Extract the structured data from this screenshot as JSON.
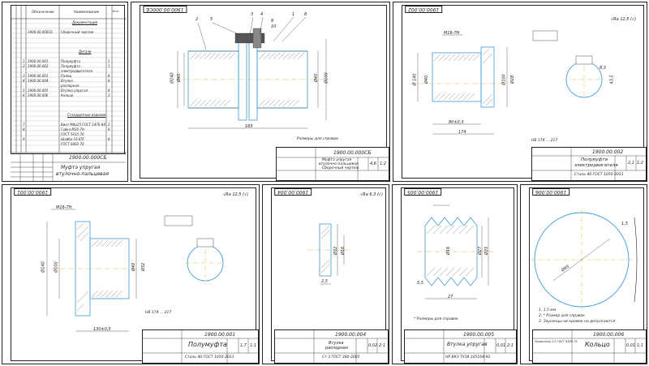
{
  "spec_sheet": {
    "header": {
      "col_designation": "Обозначение",
      "col_name": "Наименование",
      "col_qty": "Кол."
    },
    "section_docs": "Документация",
    "doc_rows": [
      {
        "code": "1900.00.000СБ",
        "name": "Сборочный чертеж"
      }
    ],
    "section_parts": "Детали",
    "part_rows": [
      {
        "pos": "1",
        "code": "1900.00.001",
        "name": "Полумуфта",
        "qty": "1"
      },
      {
        "pos": "2",
        "code": "1900.00.002",
        "name": "Полумуфта",
        "qty": "1"
      },
      {
        "pos": "",
        "code": "",
        "name": "электродвигателя",
        "qty": ""
      },
      {
        "pos": "3",
        "code": "1900.00.003",
        "name": "Палец",
        "qty": "8"
      },
      {
        "pos": "4",
        "code": "1900.00.004",
        "name": "Втулка",
        "qty": "8"
      },
      {
        "pos": "",
        "code": "",
        "name": "распорная",
        "qty": ""
      },
      {
        "pos": "5",
        "code": "1900.00.005",
        "name": "Втулка упругая",
        "qty": "8"
      },
      {
        "pos": "6",
        "code": "1900.00.006",
        "name": "Кольцо",
        "qty": "2"
      }
    ],
    "section_standard": "Стандартные изделия",
    "std_rows": [
      {
        "pos": "7",
        "name": "Винт М4х25 ГОСТ 1476-84",
        "qty": "2"
      },
      {
        "pos": "8",
        "name": "Гайка М16-7Н",
        "qty": "8"
      },
      {
        "pos": "",
        "name": "ГОСТ 5915-70",
        "qty": ""
      },
      {
        "pos": "9",
        "name": "Шайба 16.65Г",
        "qty": "8"
      },
      {
        "pos": "",
        "name": "ГОСТ 6402-70",
        "qty": ""
      }
    ],
    "title_code": "1900.00.000СБ",
    "title_name_1": "Муфта упругая",
    "title_name_2": "втулочно-пальцевая"
  },
  "assembly_sheet": {
    "corner_code": "1900.00.000СБ",
    "positions": [
      "2",
      "5",
      "3",
      "4",
      "9",
      "10",
      "1",
      "8"
    ],
    "dims": [
      "Ø140",
      "Ø40",
      "Ø40",
      "Ø100",
      "165"
    ],
    "note": "Размеры для справок",
    "title_code": "1900.00.000СБ",
    "title_name_1": "Муфта упругая",
    "title_name_2": "втулочно-пальцевая",
    "title_name_3": "Сборочный чертеж",
    "scale": "1:2",
    "mass": "4,6"
  },
  "motor_halfcoupling_sheet": {
    "corner_code": "1900.00.002",
    "roughness": "√Ra 12,5 (√)",
    "dims": [
      "Ø 140",
      "Ø40",
      "Ø100",
      "Ø28",
      "80±0,3",
      "174",
      "M16-7H",
      "8,3",
      "43,5"
    ],
    "hardness": "HB 174 ... 217",
    "title_code": "1900.00.002",
    "title_name_1": "Полумуфта",
    "title_name_2": "электродвигателя",
    "material": "Сталь 40 ГОСТ 1050-2013",
    "mass": "2,1",
    "scale": "1:2"
  },
  "halfcoupling_sheet": {
    "corner_code": "1900.00.001",
    "roughness": "√Ra 12,5 (√)",
    "dims": [
      "Ø140",
      "Ø100",
      "Ø40",
      "Ø32",
      "130±0,5",
      "M16-7H"
    ],
    "hardness": "HB 174 ... 217",
    "title_code": "1900.00.001",
    "title_name": "Полумуфта",
    "material": "Сталь 40 ГОСТ 1050-2013",
    "mass": "1,7",
    "scale": "1:1"
  },
  "spacer_sheet": {
    "corner_code": "1900.00.004",
    "roughness": "√Ra 6,3 (√)",
    "dims": [
      "Ø32",
      "Ø16",
      "2,5"
    ],
    "title_code": "1900.00.004",
    "title_name_1": "Втулка",
    "title_name_2": "распорная",
    "material": "Ст 3 ГОСТ 380-2005",
    "mass": "0,02",
    "scale": "2:1"
  },
  "elastic_sleeve_sheet": {
    "corner_code": "1900.00.005",
    "dims": [
      "Ø27",
      "Ø35",
      "Ø16",
      "5,5",
      "27"
    ],
    "note": "* Размеры для справок",
    "title_code": "1900.00.005",
    "title_name": "Втулка упругая",
    "material": "НР ВКЗ ТУ38 105164-92",
    "mass": "0,01",
    "scale": "2:1"
  },
  "ring_sheet": {
    "corner_code": "1900.00.006",
    "dims": [
      "Ø95",
      "1,5"
    ],
    "notes": [
      "1. 1,5 мм",
      "2. * Размер для справок",
      "3. Заусенцы не кромок не допускаются"
    ],
    "title_code": "1900.00.006",
    "title_name": "Кольцо",
    "material": "Проволока 1,5 ГОСТ 9389-75",
    "mass": "0,01",
    "scale": "1:1"
  },
  "colors": {
    "ink": "#222222",
    "contour_blue": "#3a9bd8",
    "axis_yellow": "#d9b53a",
    "hatch": "#333333"
  }
}
